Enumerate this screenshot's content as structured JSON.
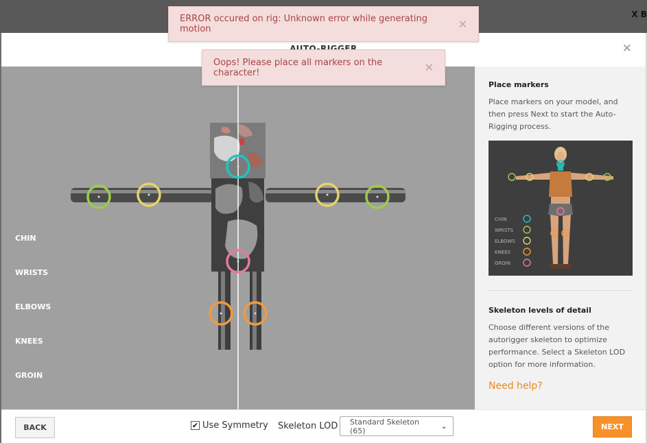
{
  "backdrop": {
    "corner_text": "X B"
  },
  "modal": {
    "title": "AUTO-RIGGER",
    "close_glyph": "✕"
  },
  "notifications": [
    {
      "text": "ERROR occured on rig: Unknown error while generating motion",
      "close": "✕"
    },
    {
      "text": "Oops! Please place all markers on the character!",
      "close": "✕"
    }
  ],
  "viewport": {
    "labels": [
      "CHIN",
      "WRISTS",
      "ELBOWS",
      "KNEES",
      "GROIN"
    ],
    "marker_colors": {
      "chin": "#1fc3c3",
      "wrists": "#9ccc4a",
      "elbows": "#e6d36a",
      "knees": "#f19a3e",
      "groin": "#e87a98"
    }
  },
  "sidebar": {
    "place_heading": "Place markers",
    "place_text": "Place markers on your model, and then press Next to start the Auto-Rigging process.",
    "preview_legend": [
      "CHIN",
      "WRISTS",
      "ELBOWS",
      "KNEES",
      "GROIN"
    ],
    "lod_heading": "Skeleton levels of detail",
    "lod_text": "Choose different versions of the autorigger skeleton to optimize performance. Select a Skeleton LOD option for more information.",
    "help_link": "Need help?"
  },
  "footer": {
    "back_label": "BACK",
    "symmetry_label": "Use Symmetry",
    "symmetry_checked": true,
    "lod_label": "Skeleton LOD",
    "lod_selected": "Standard Skeleton (65)",
    "next_label": "NEXT"
  },
  "colors": {
    "accent": "#f7922a",
    "error_bg": "#f3dddd",
    "error_text": "#a94442",
    "help_link": "#e68a1c"
  }
}
